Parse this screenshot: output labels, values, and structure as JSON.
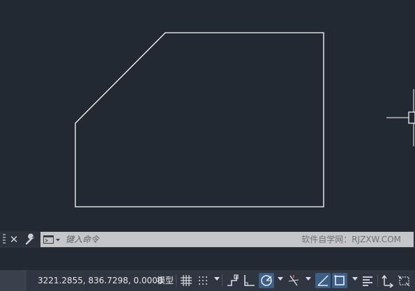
{
  "commandline": {
    "placeholder": "键入命令",
    "watermark": "软件自学网：RJZXW.COM"
  },
  "statusbar": {
    "coordinates": "3221.2855, 836.7298, 0.0000",
    "model_label": "模型"
  },
  "colors": {
    "canvas_background": "#222933",
    "geometry_stroke": "#ffffff",
    "active_toggle": "#3c5f86",
    "command_box": "#c4c6c9"
  },
  "icons": {
    "close": "close-icon",
    "customize": "wrench-icon",
    "prompt": "command-prompt-icon",
    "grid": "grid-icon",
    "snap": "snap-mode-icon",
    "infer": "infer-constraints-icon",
    "ortho": "ortho-icon",
    "polar": "polar-tracking-icon",
    "isodraft": "isometric-drafting-icon",
    "lineweight": "lineweight-icon",
    "object_snap": "object-snap-icon",
    "properties": "quick-properties-icon",
    "annotation": "annotation-scale-icon",
    "workspace": "workspace-icon"
  }
}
